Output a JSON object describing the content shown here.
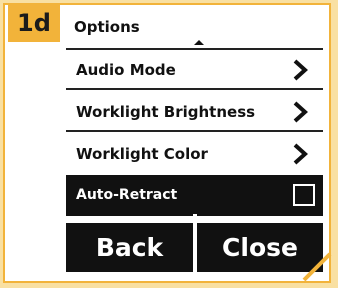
{
  "badge": {
    "label": "1d"
  },
  "header": {
    "title": "Options"
  },
  "menu": {
    "items": [
      {
        "label": "Audio Mode"
      },
      {
        "label": "Worklight Brightness"
      },
      {
        "label": "Worklight Color"
      }
    ],
    "toggle": {
      "label": "Auto-Retract",
      "checked": false
    }
  },
  "buttons": {
    "back": "Back",
    "close": "Close"
  },
  "colors": {
    "accent": "#f2b33a",
    "background": "#f9e0a2",
    "dark": "#111111"
  }
}
